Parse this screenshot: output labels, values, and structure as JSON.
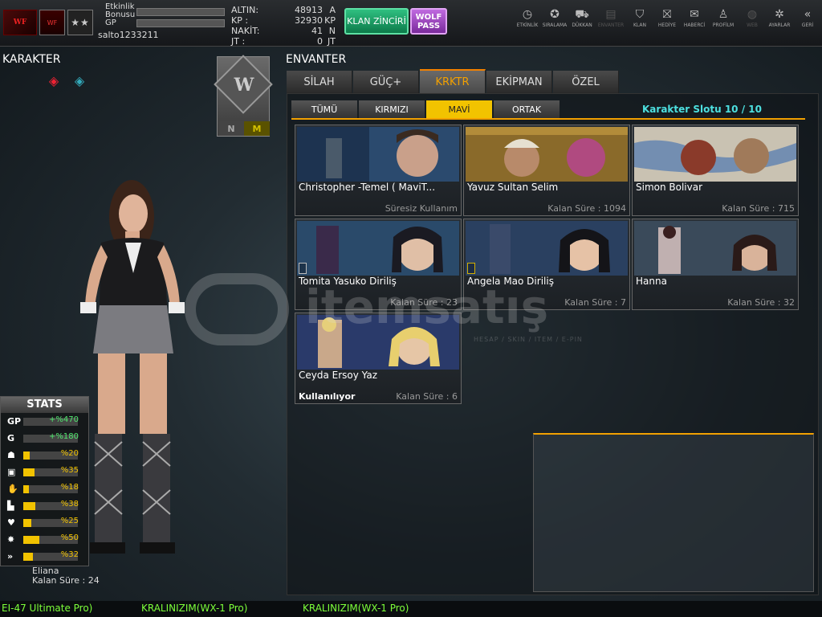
{
  "user": {
    "stat1_label": "Etkinlik\nBonusu",
    "stat1_line1": "Etkinlik",
    "stat1_line2": "Bonusu",
    "stat2_label": "GP",
    "username": "salto1233211"
  },
  "currency": [
    {
      "label": "ALTIN:",
      "value": "48913",
      "unit": "A"
    },
    {
      "label": "KP :",
      "value": "32930",
      "unit": "KP"
    },
    {
      "label": "NAKİT:",
      "value": "41",
      "unit": "N"
    },
    {
      "label": "JT :",
      "value": "0",
      "unit": "JT"
    }
  ],
  "buttons": {
    "clan": "KLAN ZİNCİRİ",
    "wolf_line1": "WOLF",
    "wolf_line2": "PASS"
  },
  "nav": [
    {
      "label": "ETKİNLİK",
      "icon": "clock-icon",
      "glyph": "◷"
    },
    {
      "label": "SIRALAMA",
      "icon": "medal-icon",
      "glyph": "✪"
    },
    {
      "label": "DÜKKAN",
      "icon": "cart-icon",
      "glyph": "⛟"
    },
    {
      "label": "ENVANTER",
      "icon": "inventory-icon",
      "glyph": "▤"
    },
    {
      "label": "KLAN",
      "icon": "shield-icon",
      "glyph": "⛉"
    },
    {
      "label": "HEDİYE",
      "icon": "gift-icon",
      "glyph": "⛝"
    },
    {
      "label": "HABERCİ",
      "icon": "megaphone-icon",
      "glyph": "✉"
    },
    {
      "label": "PROFİLM",
      "icon": "profile-icon",
      "glyph": "♙"
    },
    {
      "label": "WEB",
      "icon": "globe-icon",
      "glyph": "◍"
    },
    {
      "label": "AYARLAR",
      "icon": "gear-icon",
      "glyph": "✲"
    },
    {
      "label": "GERİ",
      "icon": "back-icon",
      "glyph": "«"
    }
  ],
  "left": {
    "title": "KARAKTER",
    "card_n": "N",
    "card_m": "M",
    "card_logo": "W"
  },
  "stats": {
    "title": "STATS",
    "rows": [
      {
        "label": "GP",
        "value": "+%470",
        "fill": 0,
        "color": "green"
      },
      {
        "label": "G",
        "value": "+%180",
        "fill": 0,
        "color": "green"
      },
      {
        "label": "",
        "value": "%20",
        "fill": 0.12,
        "color": "yellow",
        "icon": "helmet-icon"
      },
      {
        "label": "",
        "value": "%35",
        "fill": 0.2,
        "color": "yellow",
        "icon": "vest-icon"
      },
      {
        "label": "",
        "value": "%18",
        "fill": 0.1,
        "color": "yellow",
        "icon": "glove-icon"
      },
      {
        "label": "",
        "value": "%38",
        "fill": 0.22,
        "color": "yellow",
        "icon": "boot-icon"
      },
      {
        "label": "",
        "value": "%25",
        "fill": 0.15,
        "color": "yellow",
        "icon": "heart-icon"
      },
      {
        "label": "",
        "value": "%50",
        "fill": 0.3,
        "color": "yellow",
        "icon": "burst-icon"
      },
      {
        "label": "",
        "value": "%32",
        "fill": 0.18,
        "color": "yellow",
        "icon": "speed-icon"
      }
    ]
  },
  "character": {
    "name": "Eliana",
    "time": "Kalan Süre : 24"
  },
  "inventory": {
    "title": "ENVANTER",
    "tabs": [
      "SİLAH",
      "GÜÇ+",
      "KRKTR",
      "EKİPMAN",
      "ÖZEL"
    ],
    "active_tab": 2,
    "subtabs": [
      "TÜMÜ",
      "KIRMIZI",
      "MAVİ",
      "ORTAK"
    ],
    "active_subtab": 2,
    "slot_info": "Karakter Slotu 10 / 10",
    "items": [
      {
        "name": "Christopher -Temel ( MaviT...",
        "time": "Süresiz Kullanım",
        "status": ""
      },
      {
        "name": "Yavuz Sultan Selim",
        "time": "Kalan Süre : 1094",
        "status": ""
      },
      {
        "name": "Simon Bolivar",
        "time": "Kalan Süre : 715",
        "status": ""
      },
      {
        "name": "Tomita Yasuko Diriliş",
        "time": "Kalan Süre : 23",
        "status": ""
      },
      {
        "name": "Angela Mao Diriliş",
        "time": "Kalan Süre : 7",
        "status": ""
      },
      {
        "name": "Hanna",
        "time": "Kalan Süre : 32",
        "status": ""
      },
      {
        "name": "Ceyda Ersoy Yaz",
        "time": "Kalan Süre : 6",
        "status": "Kullanılıyor"
      }
    ]
  },
  "watermark": {
    "text": "itemsatış",
    "sub": "HESAP / SKIN / ITEM / E-PIN"
  },
  "ticker": [
    "EI-47 Ultimate Pro)",
    "KRALINIZIM(WX-1 Pro)",
    "KRALINIZIM(WX-1 Pro)"
  ],
  "colors": {
    "accent": "#f2a000",
    "slot": "#4de0e0",
    "ticker": "#7dff3a",
    "clan": "#2fbf80",
    "wolf": "#c06ae0"
  }
}
